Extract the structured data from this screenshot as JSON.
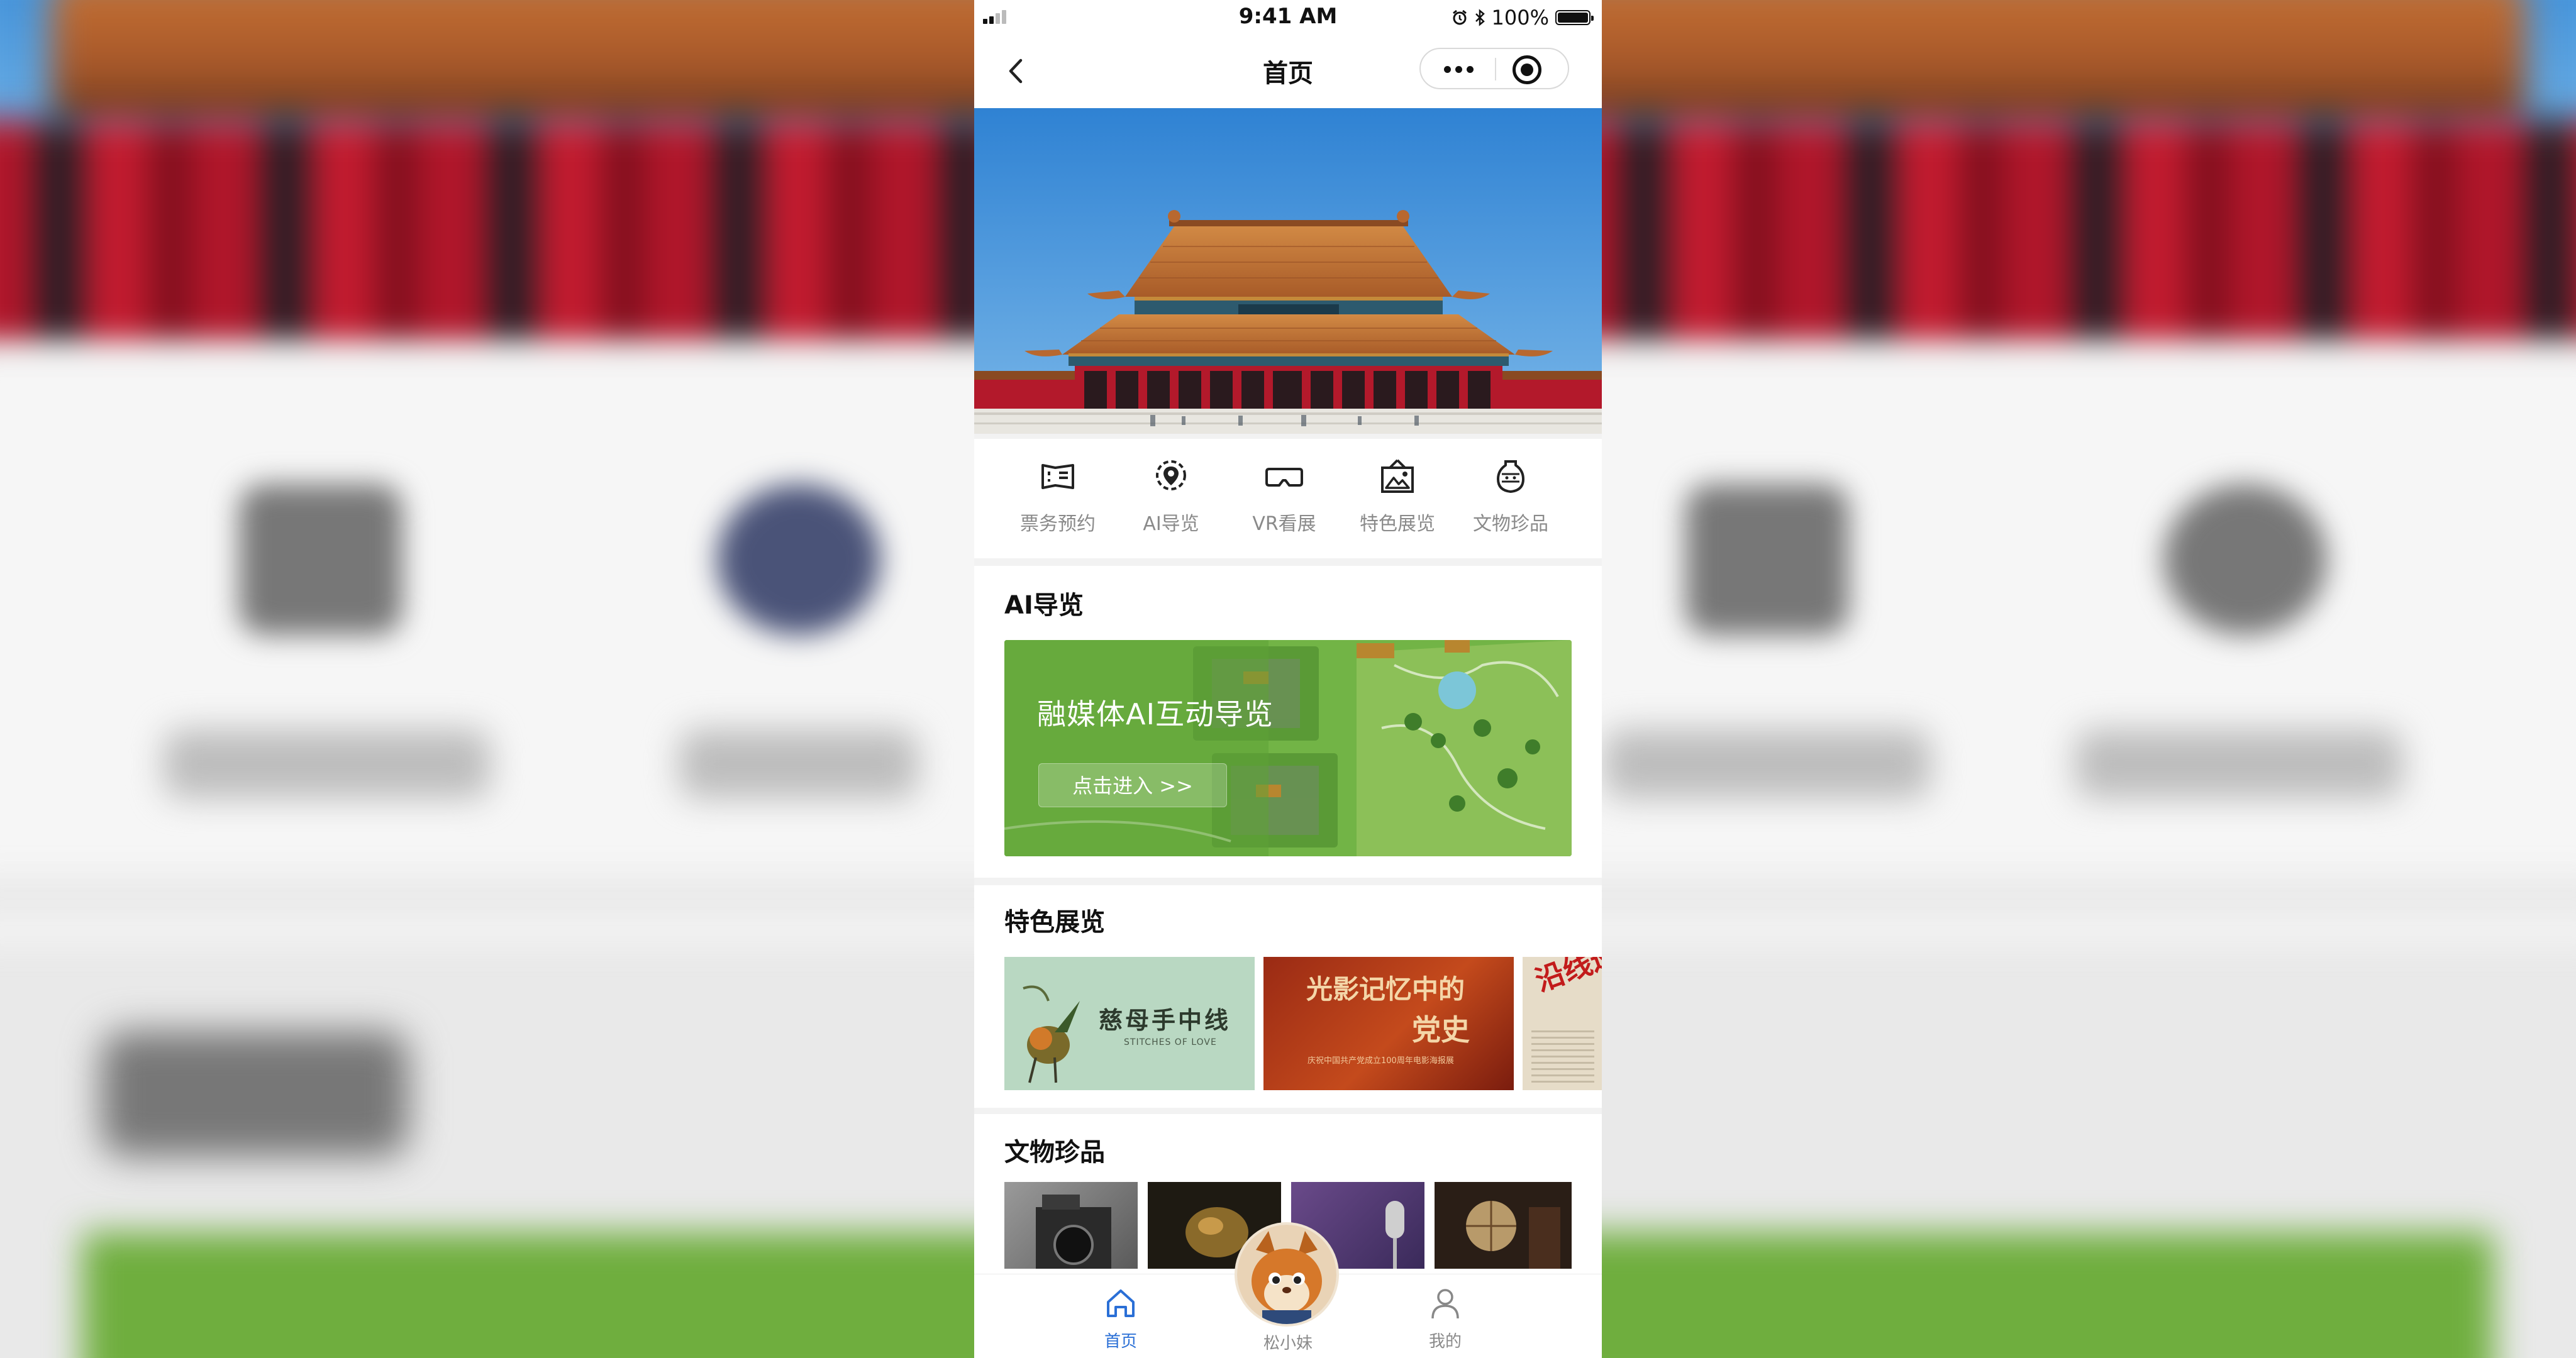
{
  "status_bar": {
    "time": "9:41 AM",
    "battery": "100%"
  },
  "nav": {
    "title": "首页"
  },
  "quick_nav": [
    {
      "label": "票务预约",
      "icon": "ticket-icon"
    },
    {
      "label": "AI导览",
      "icon": "location-pin-icon"
    },
    {
      "label": "VR看展",
      "icon": "vr-headset-icon"
    },
    {
      "label": "特色展览",
      "icon": "picture-frame-icon"
    },
    {
      "label": "文物珍品",
      "icon": "vase-icon"
    }
  ],
  "ai_section": {
    "title": "AI导览",
    "banner_title": "融媒体AI互动导览",
    "banner_button": "点击进入 >>"
  },
  "exhibitions": {
    "title": "特色展览",
    "cards": [
      {
        "title": "慈母手中线",
        "subtitle": "STITCHES OF LOVE"
      },
      {
        "title_line1": "光影记忆中的",
        "title_line2": "党史",
        "subtitle": "庆祝中国共产党成立100周年电影海报展"
      },
      {
        "title": "沿线巡"
      }
    ]
  },
  "relics": {
    "title": "文物珍品"
  },
  "tab_bar": [
    {
      "label": "首页",
      "icon": "home-icon",
      "active": true
    },
    {
      "label": "松小妹",
      "icon": "squirrel-mascot-icon",
      "active": false
    },
    {
      "label": "我的",
      "icon": "user-icon",
      "active": false
    }
  ],
  "colors": {
    "accent": "#2a6fd6",
    "banner_green": "#6aae3f",
    "palace_red": "#b0162a"
  }
}
